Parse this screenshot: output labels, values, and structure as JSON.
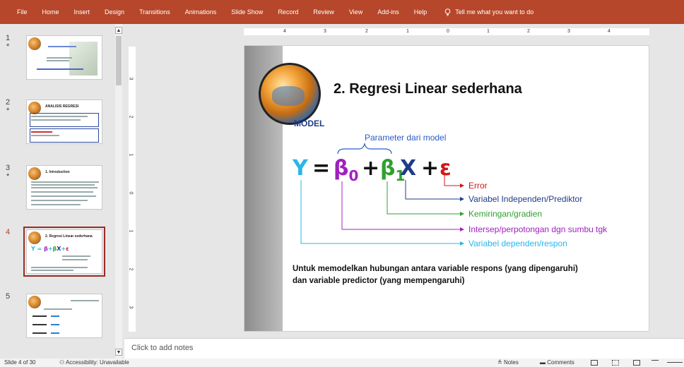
{
  "ribbon": {
    "tabs": [
      "File",
      "Home",
      "Insert",
      "Design",
      "Transitions",
      "Animations",
      "Slide Show",
      "Record",
      "Review",
      "View",
      "Add-ins",
      "Help"
    ],
    "tell_me": "Tell me what you want to do"
  },
  "thumbnails": [
    {
      "num": "1",
      "star": "*",
      "title": ""
    },
    {
      "num": "2",
      "star": "*",
      "title": "ANALISIS REGRESI"
    },
    {
      "num": "3",
      "star": "*",
      "title": "1. Introduction"
    },
    {
      "num": "4",
      "star": "",
      "title": "2. Regresi Linear sederhana"
    },
    {
      "num": "5",
      "star": "",
      "title": ""
    }
  ],
  "ruler": {
    "h_marks": [
      "4",
      "3",
      "2",
      "1",
      "0",
      "1",
      "2",
      "3",
      "4"
    ],
    "v_marks": [
      "3",
      "2",
      "1",
      "0",
      "1",
      "2",
      "3"
    ]
  },
  "slide": {
    "title": "2. Regresi Linear sederhana",
    "model_label": "MODEL",
    "param_label": "Parameter dari model",
    "equation": {
      "y": "Y",
      "eq": "=",
      "b0": "β",
      "b0_sub": "0",
      "plus1": "+",
      "b1": "β",
      "b1_sub": "1",
      "x": "X",
      "plus2": "+",
      "eps": "ε"
    },
    "annotations": {
      "error": "Error",
      "indep": "Variabel Independen/Prediktor",
      "slope": "Kemiringan/gradien",
      "intercept": "Intersep/perpotongan dgn sumbu tgk",
      "dep": "Variabel dependen/respon"
    },
    "footnote_1": "Untuk memodelkan hubungan antara variable respons (yang dipengaruhi)",
    "footnote_2": "dan variable predictor (yang mempengaruhi)"
  },
  "notes": {
    "placeholder": "Click to add notes"
  },
  "status": {
    "slide_count": "Slide 4 of 30",
    "accessibility": "Accessibility: Unavailable",
    "notes_label": "Notes",
    "comments_label": "Comments"
  },
  "colors": {
    "ribbon": "#b7472a",
    "y": "#29b6e8",
    "beta0": "#a020c0",
    "beta1": "#2fa02f",
    "x": "#1f3c88",
    "epsilon": "#d01818"
  }
}
